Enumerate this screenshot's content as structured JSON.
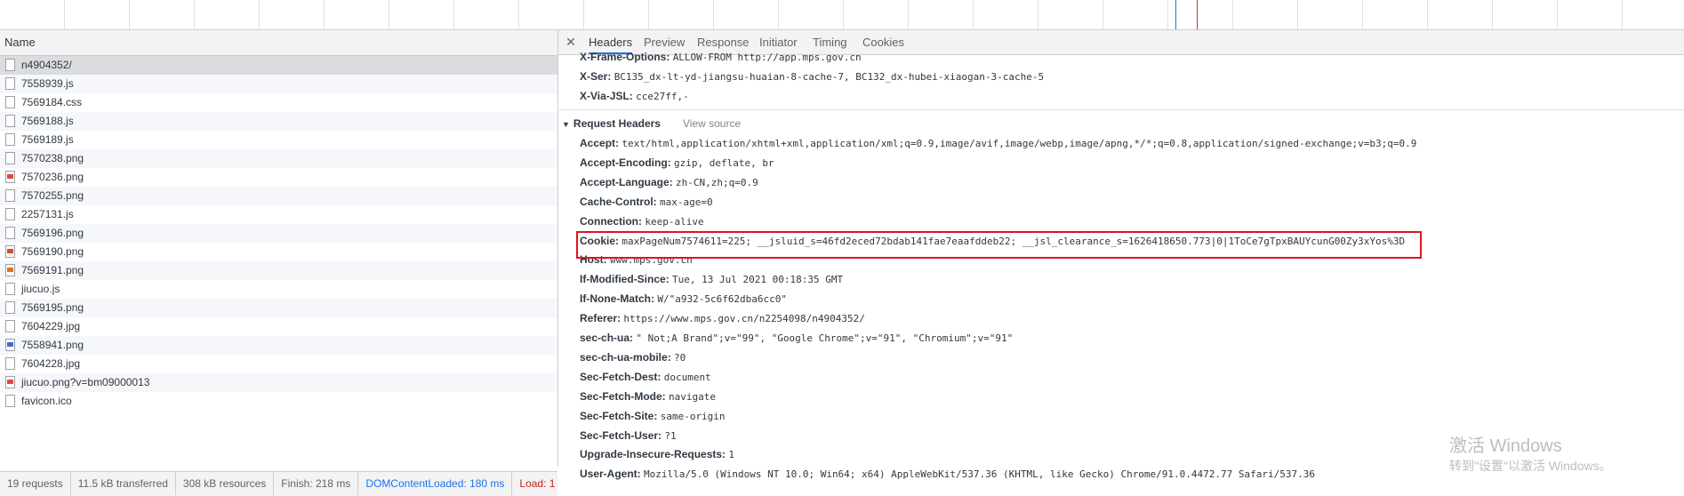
{
  "colors": {
    "accent": "#1a73e8",
    "error": "#c5221f",
    "highlight_box": "#e0141e",
    "selected_row": "#dadce0",
    "dom_marker": "#1a73e8",
    "load_marker": "#d93025"
  },
  "request_list": {
    "column_name": "Name",
    "rows": [
      {
        "name": "n4904352/",
        "icon": "document-icon"
      },
      {
        "name": "7558939.js",
        "icon": "script-icon"
      },
      {
        "name": "7569184.css",
        "icon": "stylesheet-icon"
      },
      {
        "name": "7569188.js",
        "icon": "script-icon"
      },
      {
        "name": "7569189.js",
        "icon": "script-icon"
      },
      {
        "name": "7570238.png",
        "icon": "image-icon"
      },
      {
        "name": "7570236.png",
        "icon": "image-icon"
      },
      {
        "name": "7570255.png",
        "icon": "image-icon"
      },
      {
        "name": "2257131.js",
        "icon": "script-icon"
      },
      {
        "name": "7569196.png",
        "icon": "image-icon"
      },
      {
        "name": "7569190.png",
        "icon": "image-icon"
      },
      {
        "name": "7569191.png",
        "icon": "image-icon"
      },
      {
        "name": "jiucuo.js",
        "icon": "script-icon"
      },
      {
        "name": "7569195.png",
        "icon": "image-icon"
      },
      {
        "name": "7604229.jpg",
        "icon": "image-icon"
      },
      {
        "name": "7558941.png",
        "icon": "image-icon"
      },
      {
        "name": "7604228.jpg",
        "icon": "image-icon"
      },
      {
        "name": "jiucuo.png?v=bm09000013",
        "icon": "image-icon"
      },
      {
        "name": "favicon.ico",
        "icon": "image-icon"
      }
    ]
  },
  "status_bar": {
    "requests": "19 requests",
    "transferred": "11.5 kB transferred",
    "resources": "308 kB resources",
    "finish": "Finish: 218 ms",
    "dom_content_loaded": "DOMContentLoaded: 180 ms",
    "load": "Load: 1"
  },
  "detail": {
    "tabs": [
      "Headers",
      "Preview",
      "Response",
      "Initiator",
      "Timing",
      "Cookies"
    ],
    "active_tab": "Headers",
    "response_headers_tail": [
      {
        "name": "X-Frame-Options:",
        "value": "ALLOW-FROM http://app.mps.gov.cn"
      },
      {
        "name": "X-Ser:",
        "value": "BC135_dx-lt-yd-jiangsu-huaian-8-cache-7, BC132_dx-hubei-xiaogan-3-cache-5"
      },
      {
        "name": "X-Via-JSL:",
        "value": "cce27ff,-"
      }
    ],
    "request_section_title": "Request Headers",
    "view_source": "View source",
    "request_headers": [
      {
        "name": "Accept:",
        "value": "text/html,application/xhtml+xml,application/xml;q=0.9,image/avif,image/webp,image/apng,*/*;q=0.8,application/signed-exchange;v=b3;q=0.9"
      },
      {
        "name": "Accept-Encoding:",
        "value": "gzip, deflate, br"
      },
      {
        "name": "Accept-Language:",
        "value": "zh-CN,zh;q=0.9"
      },
      {
        "name": "Cache-Control:",
        "value": "max-age=0"
      },
      {
        "name": "Connection:",
        "value": "keep-alive"
      },
      {
        "name": "Cookie:",
        "value": "maxPageNum7574611=225; __jsluid_s=46fd2eced72bdab141fae7eaafddeb22; __jsl_clearance_s=1626418650.773|0|1ToCe7gTpxBAUYcunG00Zy3xYos%3D"
      },
      {
        "name": "Host:",
        "value": "www.mps.gov.cn"
      },
      {
        "name": "If-Modified-Since:",
        "value": "Tue, 13 Jul 2021 00:18:35 GMT"
      },
      {
        "name": "If-None-Match:",
        "value": "W/\"a932-5c6f62dba6cc0\""
      },
      {
        "name": "Referer:",
        "value": "https://www.mps.gov.cn/n2254098/n4904352/"
      },
      {
        "name": "sec-ch-ua:",
        "value": "\" Not;A Brand\";v=\"99\", \"Google Chrome\";v=\"91\", \"Chromium\";v=\"91\""
      },
      {
        "name": "sec-ch-ua-mobile:",
        "value": "?0"
      },
      {
        "name": "Sec-Fetch-Dest:",
        "value": "document"
      },
      {
        "name": "Sec-Fetch-Mode:",
        "value": "navigate"
      },
      {
        "name": "Sec-Fetch-Site:",
        "value": "same-origin"
      },
      {
        "name": "Sec-Fetch-User:",
        "value": "?1"
      },
      {
        "name": "Upgrade-Insecure-Requests:",
        "value": "1"
      },
      {
        "name": "User-Agent:",
        "value": "Mozilla/5.0 (Windows NT 10.0; Win64; x64) AppleWebKit/537.36 (KHTML, like Gecko) Chrome/91.0.4472.77 Safari/537.36"
      }
    ]
  },
  "watermark": {
    "title": "激活 Windows",
    "subtitle": "转到\"设置\"以激活 Windows。"
  }
}
